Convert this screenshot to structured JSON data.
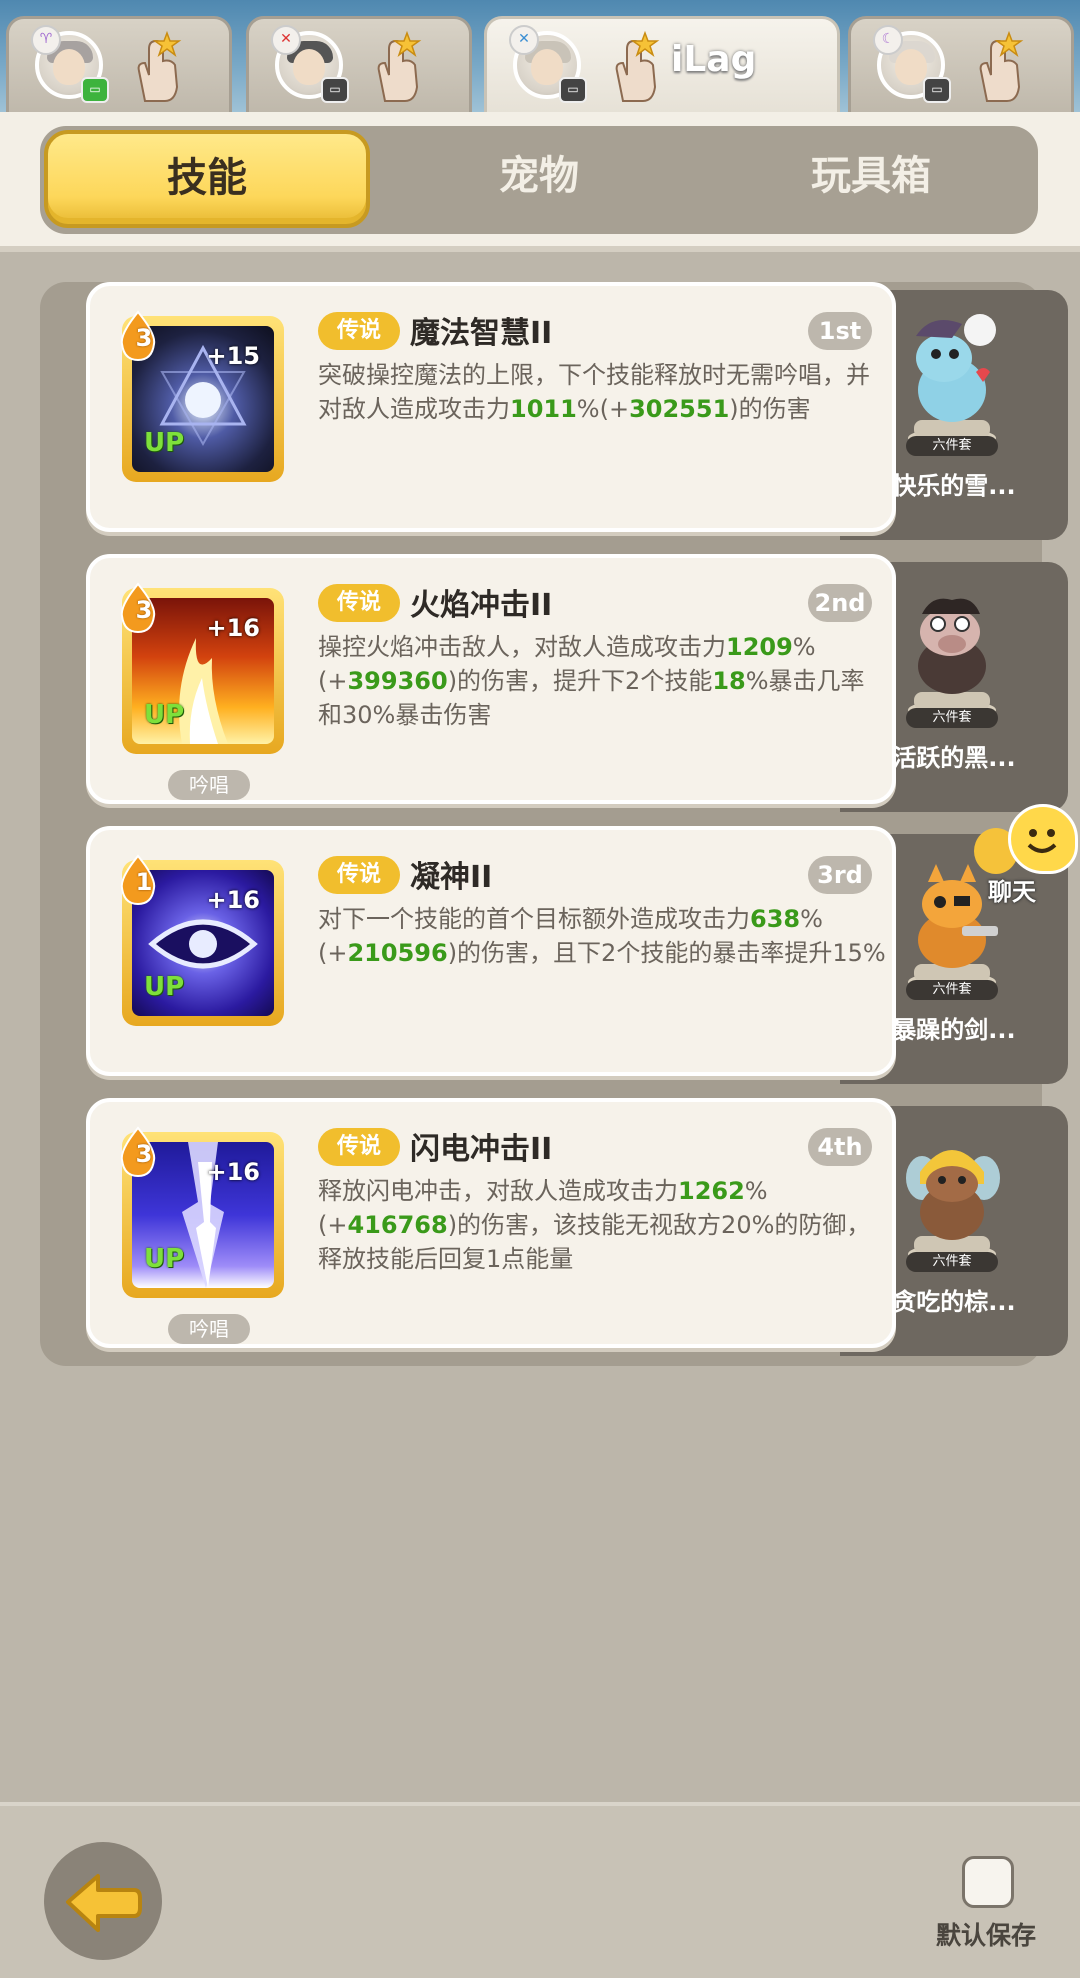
{
  "player_tabs": [
    {
      "name": "",
      "badge_icon": "aries-icon",
      "status_icon": "chat-status-icon",
      "status_color": "#3db33d"
    },
    {
      "name": "",
      "badge_icon": "sword-icon",
      "status_icon": "offline-status-icon",
      "status_color": "#444444"
    },
    {
      "name": "iLag",
      "badge_icon": "sword-icon",
      "status_icon": "offline-status-icon",
      "status_color": "#444444"
    },
    {
      "name": "",
      "badge_icon": "moon-icon",
      "status_icon": "offline-status-icon",
      "status_color": "#444444"
    }
  ],
  "main_tabs": [
    "技能",
    "宠物",
    "玩具箱"
  ],
  "active_main_tab": "技能",
  "skills": [
    {
      "level": "3",
      "plus": "+15",
      "up": "UP",
      "rarity": "传说",
      "name": "魔法智慧II",
      "rank": "1st",
      "chant": "",
      "desc_parts": [
        "突破操控魔法的上限，下个技能释放时无需吟唱，并对敌人造成攻击力",
        "1011",
        "%(+",
        "302551",
        ")的伤害"
      ],
      "pet_name": "快乐的雪...",
      "pet_set": "六件套"
    },
    {
      "level": "3",
      "plus": "+16",
      "up": "UP",
      "rarity": "传说",
      "name": "火焰冲击II",
      "rank": "2nd",
      "chant": "吟唱",
      "desc_parts": [
        "操控火焰冲击敌人，对敌人造成攻击力",
        "1209",
        "%(+",
        "399360",
        ")的伤害，提升下2个技能",
        "18",
        "%暴击几率和30%暴击伤害"
      ],
      "pet_name": "活跃的黑...",
      "pet_set": "六件套"
    },
    {
      "level": "1",
      "plus": "+16",
      "up": "UP",
      "rarity": "传说",
      "name": "凝神II",
      "rank": "3rd",
      "chant": "",
      "desc_parts": [
        "对下一个技能的首个目标额外造成攻击力",
        "638",
        "%(+",
        "210596",
        ")的伤害，且下2个技能的暴击率提升15%"
      ],
      "pet_name": "暴躁的剑...",
      "pet_set": "六件套"
    },
    {
      "level": "3",
      "plus": "+16",
      "up": "UP",
      "rarity": "传说",
      "name": "闪电冲击II",
      "rank": "4th",
      "chant": "吟唱",
      "desc_parts": [
        "释放闪电冲击，对敌人造成攻击力",
        "1262",
        "%(+",
        "416768",
        ")的伤害，该技能无视敌方20%的防御，释放技能后回复1点能量"
      ],
      "pet_name": "贪吃的棕...",
      "pet_set": "六件套"
    }
  ],
  "chat_label": "聊天",
  "default_save_label": "默认保存",
  "colors": {
    "accent_yellow": "#fdd75a",
    "green_value": "#3a9a1a",
    "rarity_gold": "#f1be2d"
  }
}
